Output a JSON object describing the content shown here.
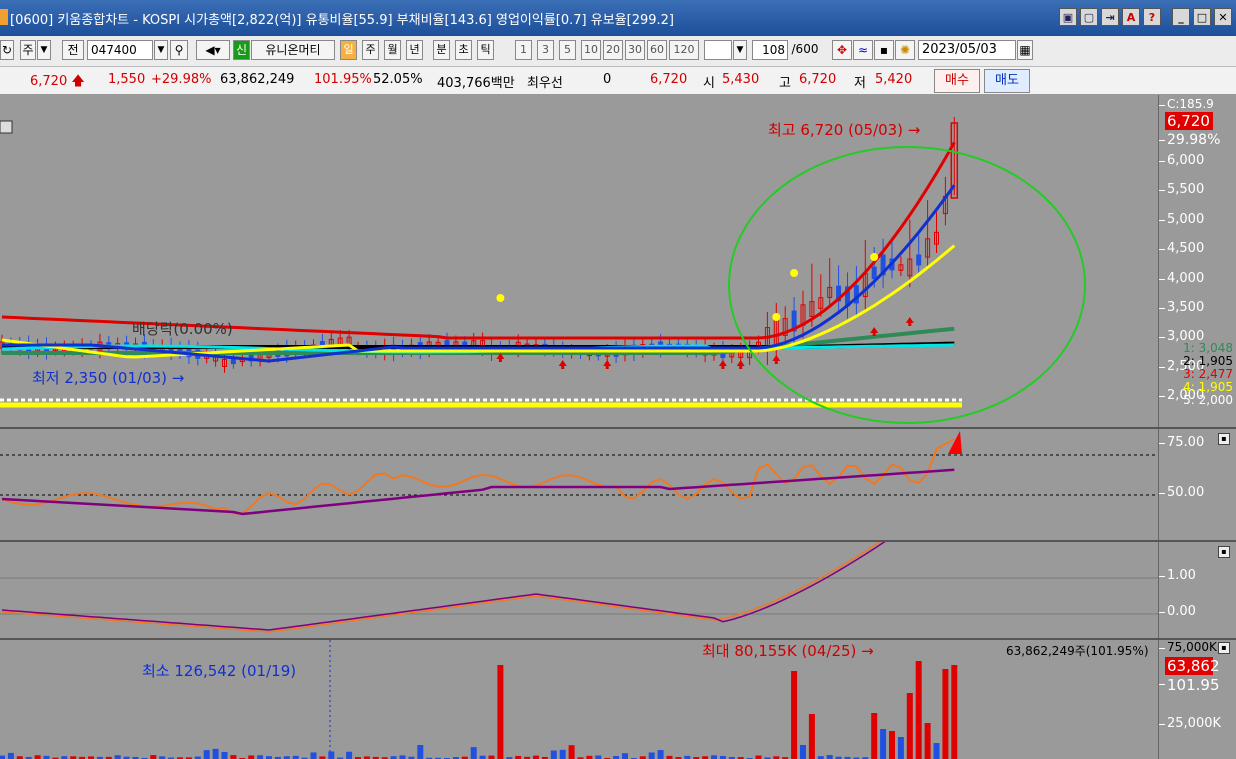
{
  "window": {
    "title": "[0600] 키움종합차트 - KOSPI 시가총액[2,822(억)] 유통비율[55.9] 부채비율[143.6] 영업이익률[0.7] 유보율[299.2]"
  },
  "toolbar": {
    "period_select": "주",
    "prev_label": "전",
    "stock_code": "047400",
    "new_badge": "신",
    "stock_name": "유니온머티",
    "periods": [
      "일",
      "주",
      "월",
      "년",
      "분",
      "초",
      "틱"
    ],
    "intervals": [
      "1",
      "3",
      "5",
      "10",
      "20",
      "30",
      "60",
      "120"
    ],
    "count": "108",
    "count_total": "/600",
    "date": "2023/05/03"
  },
  "quote": {
    "price": "6,720",
    "change": "1,550",
    "change_pct": "+29.98%",
    "volume": "63,862,249",
    "volume_ratio": "101.95%",
    "turnover": "52.05%",
    "amount": "403,766백만",
    "priority_label": "최우선",
    "priority_value": "0",
    "ask_price": "6,720",
    "open_label": "시",
    "open": "5,430",
    "high_label": "고",
    "high": "6,720",
    "low_label": "저",
    "low": "5,420",
    "buy_label": "매수",
    "sell_label": "매도"
  },
  "price_pane": {
    "high_note": "최고 6,720 (05/03) →",
    "low_note": "최저 2,350 (01/03) →",
    "dividend_note": "배당락(0.00%)",
    "axis_top_partial": "C:185.9",
    "current_price": "6,720",
    "current_pct": "29.98%",
    "axis_ticks": [
      "6,000",
      "5,500",
      "5,000",
      "4,500",
      "4,000",
      "3,500",
      "3,000",
      "2,500",
      "2,000"
    ],
    "ma_labels": [
      {
        "text": "1: 3,048",
        "color": "#2e8b57"
      },
      {
        "text": "2: 1,905",
        "color": "#000000"
      },
      {
        "text": "3: 2,477",
        "color": "#e00000"
      },
      {
        "text": "4: 1,905",
        "color": "#ffff00"
      },
      {
        "text": "5: 2,000",
        "color": "#ffffff"
      }
    ]
  },
  "rsi_pane": {
    "ticks": [
      "75.00",
      "50.00"
    ]
  },
  "macd_pane": {
    "ticks": [
      "1.00",
      "0.00"
    ]
  },
  "volume_pane": {
    "max_note": "최대 80,155K (04/25) →",
    "min_note": "최소 126,542 (01/19)",
    "current_info": "63,862,249주(101.95%)",
    "axis_top": "75,000K",
    "current_volume": "63,862",
    "current_ratio": "101.95",
    "axis_tick": "25,000K"
  },
  "colors": {
    "up": "#e00000",
    "down": "#2050e0",
    "ma5": "#e00000",
    "ma_blue": "#1030d0",
    "ma_yellow": "#ffff00",
    "ma_green": "#2e8b57",
    "ma_black": "#000000",
    "ma_cyan": "#00e5e5",
    "rsi": "#f07820",
    "signal": "#800080",
    "highlight_circle": "#22cc22"
  }
}
